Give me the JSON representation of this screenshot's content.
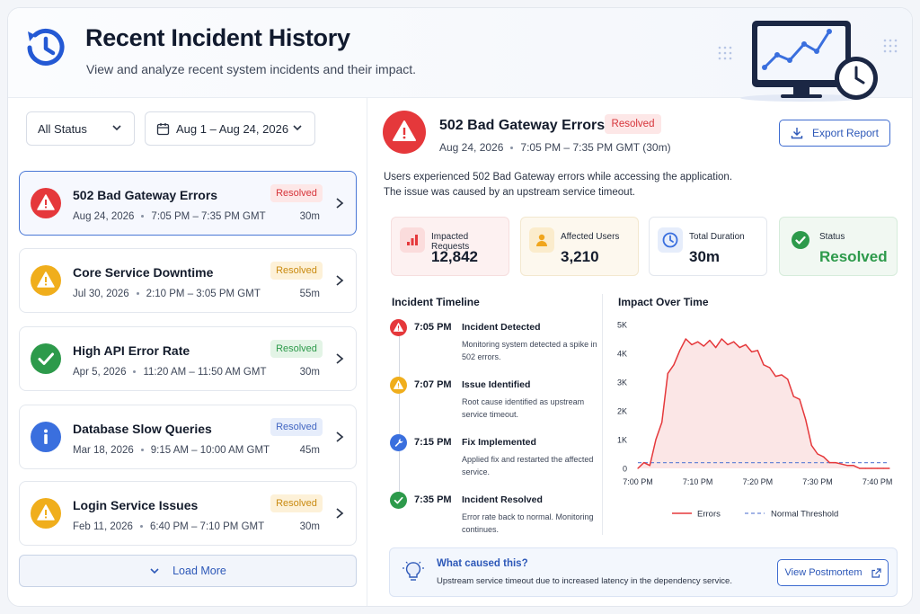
{
  "header": {
    "title": "Recent Incident History",
    "subtitle": "View and analyze recent system incidents and their impact."
  },
  "filters": {
    "status": "All Status",
    "date_range": "Aug 1 – Aug 24, 2026"
  },
  "incidents": [
    {
      "name": "502 Bad Gateway Errors",
      "date": "Aug 24, 2026",
      "time": "7:05 PM – 7:35 PM GMT",
      "duration": "30m",
      "badge": "Resolved",
      "icon": "alert-icon",
      "color": "#e5383b",
      "badge_style": "red"
    },
    {
      "name": "Core Service Downtime",
      "date": "Jul 30, 2026",
      "time": "2:10 PM – 3:05 PM GMT",
      "duration": "55m",
      "badge": "Resolved",
      "icon": "warning-icon",
      "color": "#f0ae1c",
      "badge_style": "amber"
    },
    {
      "name": "High API Error Rate",
      "date": "Apr 5, 2026",
      "time": "11:20 AM – 11:50 AM GMT",
      "duration": "30m",
      "badge": "Resolved",
      "icon": "check-icon",
      "color": "#2d9a4b",
      "badge_style": "green"
    },
    {
      "name": "Database Slow Queries",
      "date": "Mar 18, 2026",
      "time": "9:15 AM – 10:00 AM GMT",
      "duration": "45m",
      "badge": "Resolved",
      "icon": "info-icon",
      "color": "#3a6fde",
      "badge_style": "blue"
    },
    {
      "name": "Login Service Issues",
      "date": "Feb 11, 2026",
      "time": "6:40 PM – 7:10 PM GMT",
      "duration": "30m",
      "badge": "Resolved",
      "icon": "warning-icon",
      "color": "#f0ae1c",
      "badge_style": "amber"
    }
  ],
  "load_more": "Load More",
  "detail": {
    "title": "502 Bad Gateway Errors",
    "badge": "Resolved",
    "date": "Aug 24, 2026",
    "time": "7:05 PM – 7:35 PM GMT (30m)",
    "export": "Export Report",
    "desc_line1": "Users experienced 502 Bad Gateway errors while accessing the application.",
    "desc_line2": "The issue was caused by an upstream service timeout.",
    "stats": [
      {
        "label": "Impacted Requests",
        "value": "12,842",
        "icon": "bar-chart-icon",
        "bg": "#fdf1f1",
        "border": "#f6dede",
        "icon_bg": "#fbdcdc",
        "icon_color": "#e5383b"
      },
      {
        "label": "Affected Users",
        "value": "3,210",
        "icon": "user-icon",
        "bg": "#fdf8ee",
        "border": "#f3e8cf",
        "icon_bg": "#fbeccc",
        "icon_color": "#f0a51c"
      },
      {
        "label": "Total Duration",
        "value": "30m",
        "icon": "clock-icon",
        "bg": "#ffffff",
        "border": "#e3e7ee",
        "icon_bg": "#e6edfb",
        "icon_color": "#3a6fde"
      },
      {
        "label": "Status",
        "value": "Resolved",
        "icon": "check-icon",
        "bg": "#f1f8f2",
        "border": "#d6ecdb",
        "icon_bg": "#f1f8f2",
        "icon_color": "#2d9a4b"
      }
    ],
    "timeline_title": "Incident Timeline",
    "timeline": [
      {
        "time": "7:05 PM",
        "name": "Incident Detected",
        "desc": "Monitoring system detected a spike in 502 errors.",
        "icon": "alert-icon",
        "color": "#e5383b"
      },
      {
        "time": "7:07 PM",
        "name": "Issue Identified",
        "desc": "Root cause identified as upstream service timeout.",
        "icon": "warning-icon",
        "color": "#f0ae1c"
      },
      {
        "time": "7:15 PM",
        "name": "Fix Implemented",
        "desc": "Applied fix and restarted the affected service.",
        "icon": "wrench-icon",
        "color": "#3a6fde"
      },
      {
        "time": "7:35 PM",
        "name": "Incident Resolved",
        "desc": "Error rate back to normal. Monitoring continues.",
        "icon": "check-icon",
        "color": "#2d9a4b"
      }
    ],
    "chart_title": "Impact Over Time",
    "cause_title": "What caused this?",
    "cause_desc": "Upstream service timeout due to increased latency in the dependency service.",
    "postmortem": "View Postmortem"
  },
  "chart_data": {
    "type": "area",
    "title": "Impact Over Time",
    "xlabel": "",
    "ylabel": "",
    "xlim": [
      0,
      42
    ],
    "ylim": [
      0,
      5000
    ],
    "x_ticks": [
      {
        "v": 0,
        "label": "7:00 PM"
      },
      {
        "v": 10,
        "label": "7:10 PM"
      },
      {
        "v": 20,
        "label": "7:20 PM"
      },
      {
        "v": 30,
        "label": "7:30 PM"
      },
      {
        "v": 40,
        "label": "7:40 PM"
      }
    ],
    "y_ticks": [
      {
        "v": 0,
        "label": "0"
      },
      {
        "v": 1000,
        "label": "1K"
      },
      {
        "v": 2000,
        "label": "2K"
      },
      {
        "v": 3000,
        "label": "3K"
      },
      {
        "v": 4000,
        "label": "4K"
      },
      {
        "v": 5000,
        "label": "5K"
      }
    ],
    "series": [
      {
        "name": "Errors",
        "color": "#e5383b",
        "x": [
          0,
          1,
          2,
          3,
          4,
          5,
          6,
          7,
          8,
          9,
          10,
          11,
          12,
          13,
          14,
          15,
          16,
          17,
          18,
          19,
          20,
          21,
          22,
          23,
          24,
          25,
          26,
          27,
          28,
          29,
          30,
          31,
          32,
          33,
          34,
          35,
          36,
          37,
          38,
          39,
          40,
          41,
          42
        ],
        "y": [
          0,
          200,
          100,
          1000,
          1600,
          3300,
          3600,
          4100,
          4500,
          4300,
          4400,
          4250,
          4450,
          4200,
          4500,
          4300,
          4400,
          4200,
          4300,
          4050,
          4100,
          3600,
          3500,
          3200,
          3250,
          3100,
          2500,
          2400,
          1700,
          800,
          500,
          400,
          200,
          200,
          150,
          100,
          100,
          0,
          0,
          0,
          0,
          0,
          0
        ]
      },
      {
        "name": "Normal Threshold",
        "color": "#6b88d6",
        "style": "dashed",
        "x": [
          0,
          42
        ],
        "y": [
          200,
          200
        ]
      }
    ]
  }
}
